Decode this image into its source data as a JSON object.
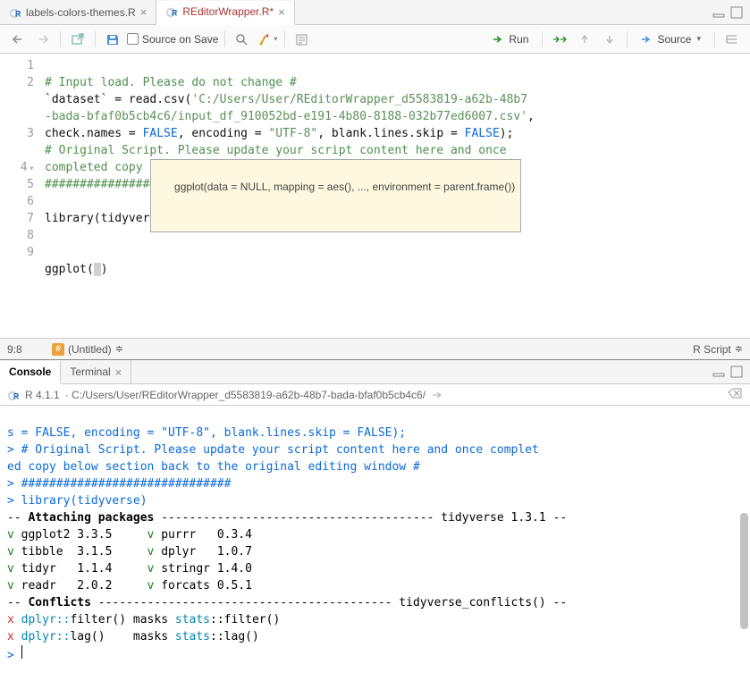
{
  "tabs": {
    "t0": {
      "label": "labels-colors-themes.R"
    },
    "t1": {
      "label": "REditorWrapper.R*"
    }
  },
  "toolbar": {
    "source_on_save": "Source on Save",
    "run": "Run",
    "source": "Source"
  },
  "gutter": [
    "1",
    "2",
    "",
    "",
    "3",
    "",
    "4",
    "5",
    "6",
    "7",
    "8",
    "9"
  ],
  "code": {
    "l1": "# Input load. Please do not change #",
    "l2a": "`dataset`",
    "l2b": " = read.csv(",
    "l2c": "'C:/Users/User/REditorWrapper_d5583819-a62b-48b7",
    "l2d": "-bada-bfaf0b5cb4c6/input_df_910052bd-e191-4b80-8188-032b77ed6007.csv'",
    "l2e": ", ",
    "l2f": "check.names = ",
    "l2g": "FALSE",
    "l2h": ", encoding = ",
    "l2i": "\"UTF-8\"",
    "l2j": ", blank.lines.skip = ",
    "l2k": "FALSE",
    "l2l": ");",
    "l3a": "# Original Script. Please update your script content here and once ",
    "l3b": "completed copy below section back to the original editing window #",
    "l4": "##############################",
    "l6a": "library",
    "l6b": "(tidyverse)",
    "l9a": "ggplot",
    "l9b": "("
  },
  "tooltip": "ggplot(data = NULL, mapping = aes(), ..., environment = parent.frame())",
  "statusbar": {
    "pos": "9:8",
    "chunk": "(Untitled)",
    "type": "R Script"
  },
  "console_tabs": {
    "console": "Console",
    "terminal": "Terminal"
  },
  "console_path": {
    "version": "R 4.1.1",
    "path": "· C:/Users/User/REditorWrapper_d5583819-a62b-48b7-bada-bfaf0b5cb4c6/"
  },
  "console": {
    "l1": "s = FALSE, encoding = \"UTF-8\", blank.lines.skip = FALSE);",
    "l2p": "> ",
    "l2": "# Original Script. Please update your script content here and once complet",
    "l3": "ed copy below section back to the original editing window #",
    "l4": "##############################",
    "l5": "library(tidyverse)",
    "attach_l": "-- ",
    "attach_b": "Attaching packages",
    "attach_r": " --------------------------------------- tidyverse 1.3.1 --",
    "pkg": {
      "p1": "ggplot2 3.3.5",
      "p1b": "purrr   0.3.4",
      "p2": "tibble  3.1.5",
      "p2b": "dplyr   1.0.7",
      "p3": "tidyr   1.1.4",
      "p3b": "stringr 1.4.0",
      "p4": "readr   2.0.2",
      "p4b": "forcats 0.5.1"
    },
    "conf_l": "-- ",
    "conf_b": "Conflicts",
    "conf_r": " ------------------------------------------ tidyverse_conflicts() --",
    "c1a": "dplyr::",
    "c1b": "filter()",
    "c1c": " masks ",
    "c1d": "stats::filter()",
    "c2a": "dplyr::",
    "c2b": "lag()",
    "c2c": "    masks ",
    "c2d": "stats::lag()",
    "prompt": "> "
  }
}
